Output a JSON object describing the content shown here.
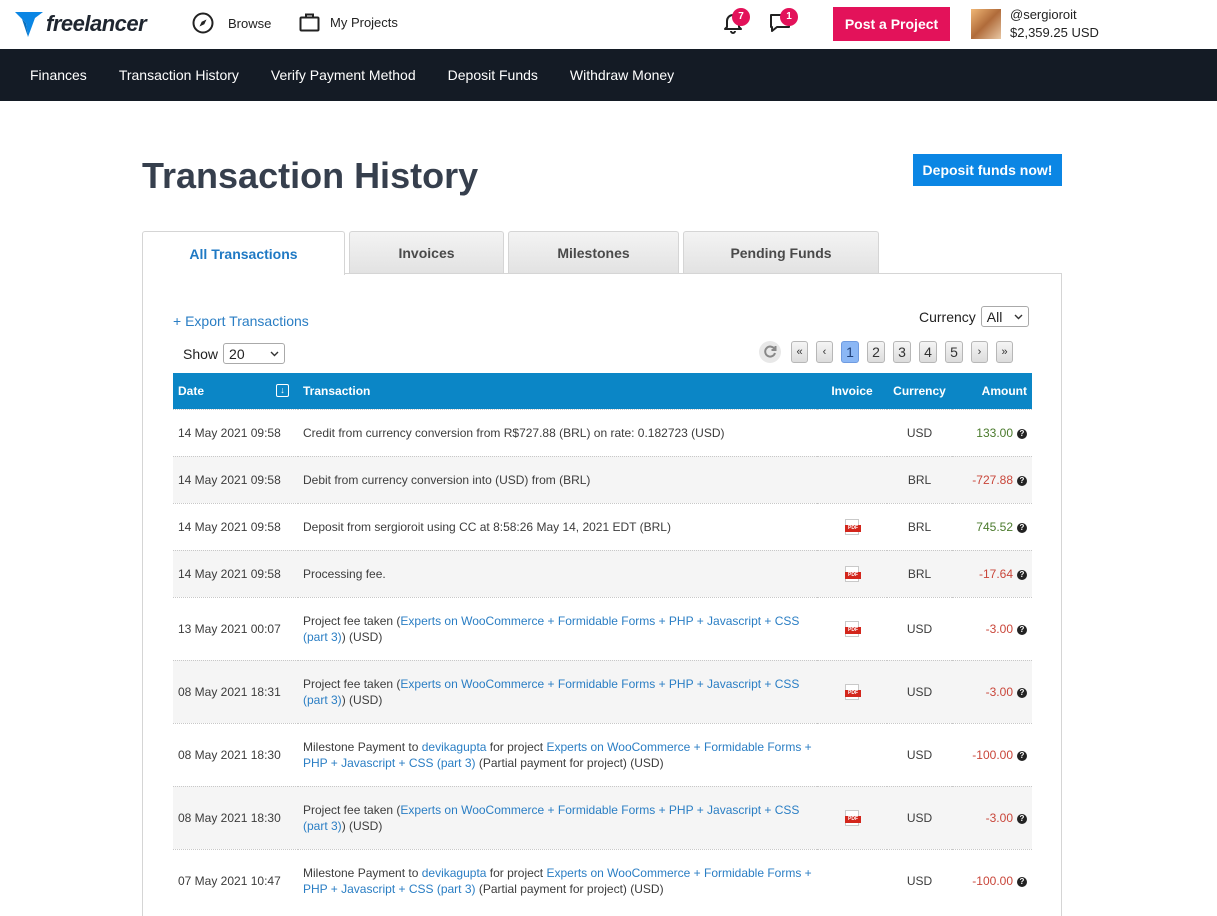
{
  "brand": {
    "name": "freelancer",
    "color": "#0b86e4"
  },
  "topnav": {
    "browse_label": "Browse",
    "projects_label": "My Projects",
    "notifications_count": "7",
    "messages_count": "1",
    "post_project_label": "Post a Project",
    "username": "@sergioroit",
    "balance": "$2,359.25 USD"
  },
  "subnav": {
    "items": [
      "Finances",
      "Transaction History",
      "Verify Payment Method",
      "Deposit Funds",
      "Withdraw Money"
    ]
  },
  "page": {
    "title": "Transaction History",
    "deposit_button": "Deposit funds now!"
  },
  "tabs": [
    "All Transactions",
    "Invoices",
    "Milestones",
    "Pending Funds"
  ],
  "controls": {
    "export_label": "+ Export Transactions",
    "currency_label": "Currency",
    "currency_value": "All",
    "show_label": "Show",
    "show_value": "20",
    "pages": [
      "1",
      "2",
      "3",
      "4",
      "5"
    ],
    "current_page": "1"
  },
  "table": {
    "columns": [
      "Date",
      "Transaction",
      "Invoice",
      "Currency",
      "Amount"
    ],
    "rows": [
      {
        "date": "14 May 2021 09:58",
        "parts": [
          {
            "t": "Credit from currency conversion from R$727.88 (BRL) on rate: 0.182723 (USD)"
          }
        ],
        "invoice": false,
        "currency": "USD",
        "amount": "133.00",
        "sign": "pos"
      },
      {
        "date": "14 May 2021 09:58",
        "parts": [
          {
            "t": "Debit from currency conversion into (USD) from (BRL)"
          }
        ],
        "invoice": false,
        "currency": "BRL",
        "amount": "-727.88",
        "sign": "neg"
      },
      {
        "date": "14 May 2021 09:58",
        "parts": [
          {
            "t": "Deposit from sergioroit using CC at 8:58:26 May 14, 2021 EDT (BRL)"
          }
        ],
        "invoice": true,
        "currency": "BRL",
        "amount": "745.52",
        "sign": "pos"
      },
      {
        "date": "14 May 2021 09:58",
        "parts": [
          {
            "t": "Processing fee."
          }
        ],
        "invoice": true,
        "currency": "BRL",
        "amount": "-17.64",
        "sign": "neg"
      },
      {
        "date": "13 May 2021 00:07",
        "parts": [
          {
            "t": "Project fee taken ("
          },
          {
            "t": "Experts on WooCommerce + Formidable Forms + PHP + Javascript + CSS (part 3)",
            "link": true
          },
          {
            "t": ") (USD)"
          }
        ],
        "invoice": true,
        "currency": "USD",
        "amount": "-3.00",
        "sign": "neg"
      },
      {
        "date": "08 May 2021 18:31",
        "parts": [
          {
            "t": "Project fee taken ("
          },
          {
            "t": "Experts on WooCommerce + Formidable Forms + PHP + Javascript + CSS (part 3)",
            "link": true
          },
          {
            "t": ") (USD)"
          }
        ],
        "invoice": true,
        "currency": "USD",
        "amount": "-3.00",
        "sign": "neg"
      },
      {
        "date": "08 May 2021 18:30",
        "parts": [
          {
            "t": "Milestone Payment to "
          },
          {
            "t": "devikagupta",
            "link": true
          },
          {
            "t": " for project "
          },
          {
            "t": "Experts on WooCommerce + Formidable Forms + PHP + Javascript + CSS (part 3)",
            "link": true
          },
          {
            "t": " (Partial payment for project) (USD)"
          }
        ],
        "invoice": false,
        "currency": "USD",
        "amount": "-100.00",
        "sign": "neg"
      },
      {
        "date": "08 May 2021 18:30",
        "parts": [
          {
            "t": "Project fee taken ("
          },
          {
            "t": "Experts on WooCommerce + Formidable Forms + PHP + Javascript + CSS (part 3)",
            "link": true
          },
          {
            "t": ") (USD)"
          }
        ],
        "invoice": true,
        "currency": "USD",
        "amount": "-3.00",
        "sign": "neg"
      },
      {
        "date": "07 May 2021 10:47",
        "parts": [
          {
            "t": "Milestone Payment to "
          },
          {
            "t": "devikagupta",
            "link": true
          },
          {
            "t": " for project "
          },
          {
            "t": "Experts on WooCommerce + Formidable Forms + PHP + Javascript + CSS (part 3)",
            "link": true
          },
          {
            "t": " (Partial payment for project) (USD)"
          }
        ],
        "invoice": false,
        "currency": "USD",
        "amount": "-100.00",
        "sign": "neg"
      }
    ]
  }
}
